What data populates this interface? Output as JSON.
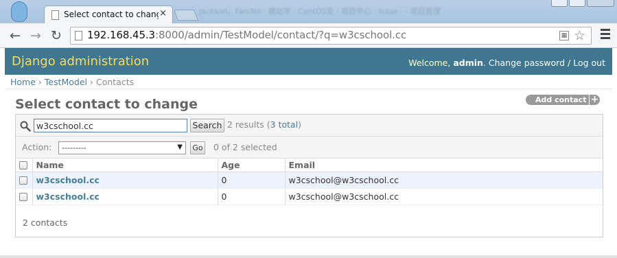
{
  "browser": {
    "tab_title": "Select contact to change",
    "tab_close": "×",
    "url_host": "192.168.45.3",
    "url_rest": ":8000/admin/TestModel/contact/?q=w3cschool.cc",
    "background_tabs": "  jackson、Fan/No  ·  建站学 · CentOS安  ·  项目中心 · Issue ·  ·  项目管理"
  },
  "header": {
    "branding": "Django administration",
    "welcome": "Welcome, ",
    "username": "admin",
    "separator1": ". ",
    "change_password": "Change password",
    "separator2": " / ",
    "logout": "Log out"
  },
  "breadcrumbs": {
    "home": "Home",
    "sep": " › ",
    "app": "TestModel",
    "current": "Contacts"
  },
  "page_title": "Select contact to change",
  "add_button": {
    "label": "Add contact",
    "plus": "+"
  },
  "search": {
    "value": "w3cschool.cc",
    "button": "Search",
    "results_prefix": "2 results (",
    "results_total": "3 total",
    "results_suffix": ")"
  },
  "actions": {
    "label": "Action:",
    "selected_option": "---------",
    "go": "Go",
    "counter": "0 of 2 selected"
  },
  "table": {
    "headers": [
      "Name",
      "Age",
      "Email"
    ],
    "rows": [
      {
        "name": "w3cschool.cc",
        "age": "0",
        "email": "w3cschool@w3cschool.cc"
      },
      {
        "name": "w3cschool.cc",
        "age": "0",
        "email": "w3cschool@w3cschool.cc"
      }
    ]
  },
  "paginator": "2 contacts",
  "colors": {
    "header_bg": "#417690",
    "branding": "#f5dd5d",
    "link": "#447e9b",
    "row_highlight": "#edf3fe"
  }
}
